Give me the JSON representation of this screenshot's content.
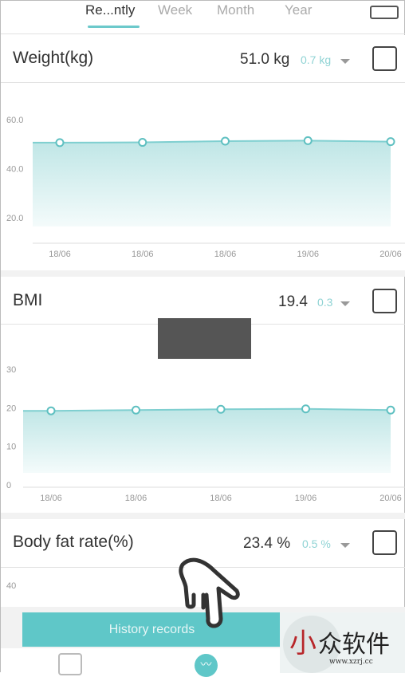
{
  "tabs": [
    {
      "label": "Re...ntly",
      "active": true
    },
    {
      "label": "Week"
    },
    {
      "label": "Month"
    },
    {
      "label": "Year"
    }
  ],
  "accent": "#6cc9cb",
  "cards": [
    {
      "title": "Weight(kg)",
      "value": "51.0 kg",
      "delta": "0.7 kg",
      "delta_dir": "down",
      "chart_data": {
        "type": "area",
        "x": [
          "18/06",
          "18/06",
          "18/06",
          "19/06",
          "20/06"
        ],
        "values": [
          50.6,
          50.7,
          51.2,
          51.4,
          51.0
        ],
        "yticks": [
          "60.0",
          "40.0",
          "20.0"
        ],
        "ylim": [
          17,
          60
        ]
      }
    },
    {
      "title": "BMI",
      "value": "19.4",
      "delta": "0.3",
      "delta_dir": "down",
      "chart_data": {
        "type": "area",
        "x": [
          "18/06",
          "18/06",
          "18/06",
          "19/06",
          "20/06"
        ],
        "values": [
          19.2,
          19.4,
          19.6,
          19.7,
          19.4
        ],
        "yticks": [
          "30",
          "20",
          "10",
          "0"
        ],
        "ylim": [
          0,
          30
        ]
      }
    },
    {
      "title": "Body fat rate(%)",
      "value": "23.4 %",
      "delta": "0.5 %",
      "delta_dir": "down",
      "chart_data": {
        "yticks": [
          "40"
        ]
      }
    }
  ],
  "history_button": "History records",
  "watermark": {
    "text": "小众软件",
    "url": "www.xzrj.cc"
  }
}
